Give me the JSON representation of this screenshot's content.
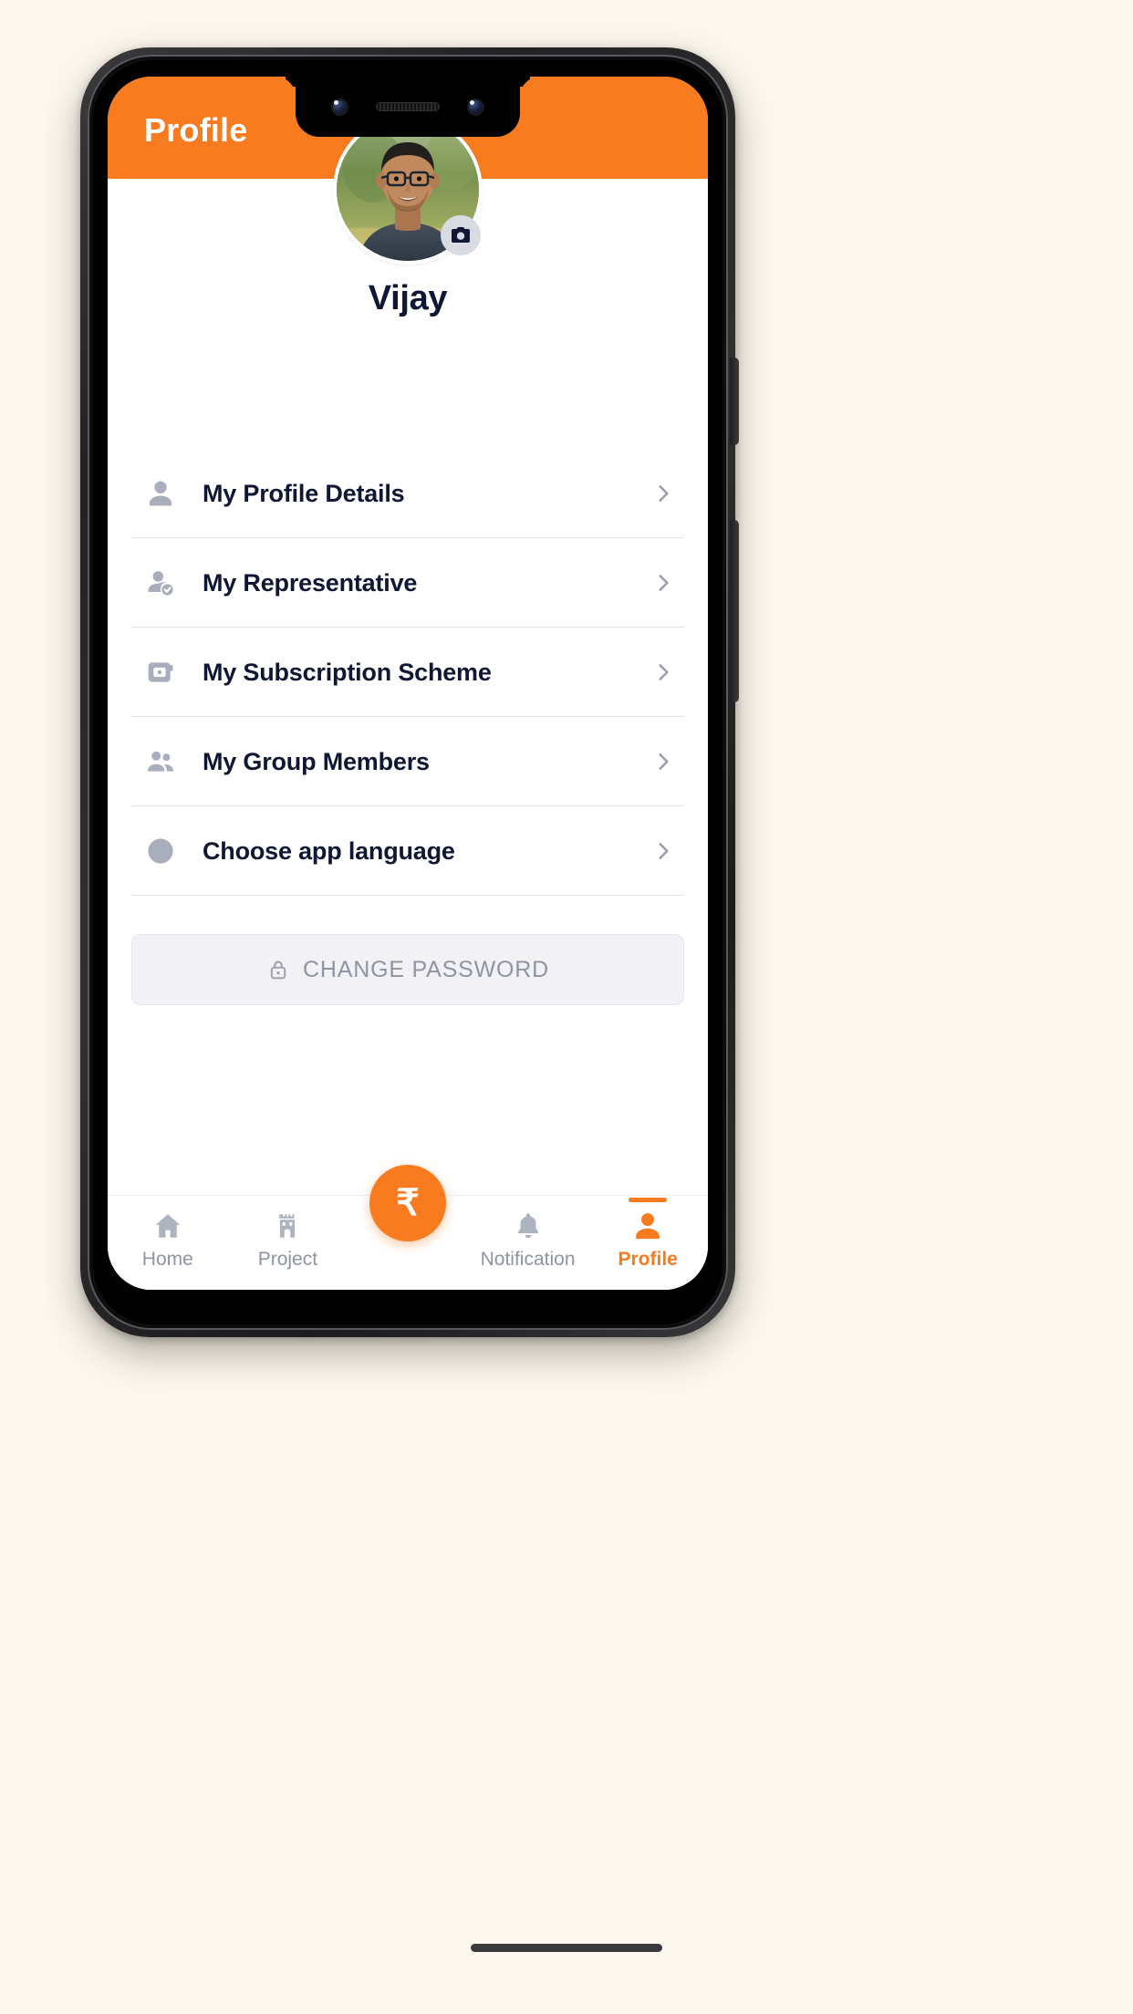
{
  "app": {
    "header": {
      "title": "Profile",
      "bg_color": "#f97b1f",
      "title_color": "#ffffff"
    },
    "theme": {
      "accent": "#f97b1f",
      "text_dark": "#101735",
      "icon_gray": "#a9aebd",
      "muted": "#8f94a3",
      "divider": "#e2e2ea",
      "surface": "#ffffff",
      "button_bg": "#f2f2f6"
    },
    "profile": {
      "avatar_name": "avatar-photo",
      "camera_badge_icon": "camera-icon",
      "user_name": "Vijay"
    },
    "menu": {
      "items": [
        {
          "label": "My Profile Details",
          "icon": "person-icon",
          "chevron": "chevron-right-icon"
        },
        {
          "label": "My Representative",
          "icon": "person-check-icon",
          "chevron": "chevron-right-icon"
        },
        {
          "label": "My Subscription Scheme",
          "icon": "wallet-card-icon",
          "chevron": "chevron-right-icon"
        },
        {
          "label": "My Group Members",
          "icon": "people-group-icon",
          "chevron": "chevron-right-icon"
        },
        {
          "label": "Choose app language",
          "icon": "globe-icon",
          "chevron": "chevron-right-icon"
        }
      ]
    },
    "change_password": {
      "label": "CHANGE PASSWORD",
      "icon": "lock-icon"
    },
    "bottom_nav": {
      "items": [
        {
          "label": "Home",
          "icon": "home-icon",
          "active": false
        },
        {
          "label": "Project",
          "icon": "tower-icon",
          "active": false
        },
        {
          "label": "",
          "icon": "rupee-icon",
          "active": false,
          "fab": true,
          "glyph": "₹"
        },
        {
          "label": "Notification",
          "icon": "bell-icon",
          "active": false
        },
        {
          "label": "Profile",
          "icon": "person-solid-icon",
          "active": true
        }
      ]
    }
  }
}
